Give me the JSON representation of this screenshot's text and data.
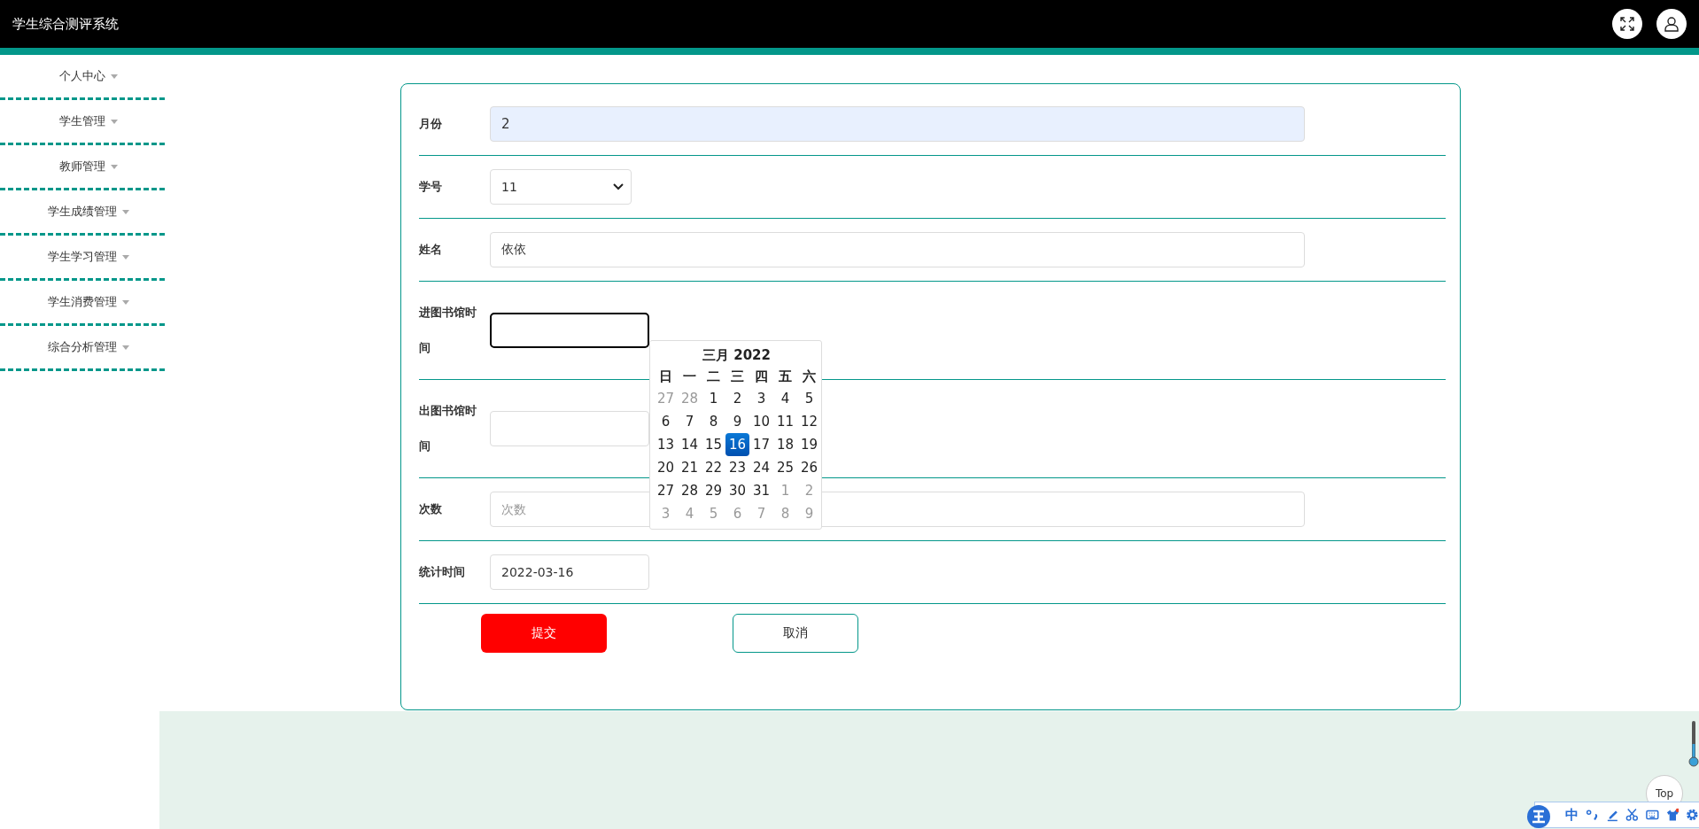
{
  "header": {
    "title": "学生综合测评系统"
  },
  "sidebar": {
    "items": [
      {
        "label": "个人中心"
      },
      {
        "label": "学生管理"
      },
      {
        "label": "教师管理"
      },
      {
        "label": "学生成绩管理"
      },
      {
        "label": "学生学习管理"
      },
      {
        "label": "学生消费管理"
      },
      {
        "label": "综合分析管理"
      }
    ]
  },
  "form": {
    "fields": [
      {
        "kind": "text",
        "label": "月份",
        "value": "2",
        "autofilled": true,
        "focused": false
      },
      {
        "kind": "select",
        "label": "学号",
        "value": "11",
        "autofilled": false,
        "focused": false
      },
      {
        "kind": "text",
        "label": "姓名",
        "value": "依依",
        "autofilled": false,
        "focused": false
      },
      {
        "kind": "date",
        "label": "进图书馆时间",
        "autofilled": false,
        "focused": true
      },
      {
        "kind": "date",
        "label": "出图书馆时间",
        "autofilled": false,
        "focused": false
      },
      {
        "kind": "text",
        "label": "次数",
        "placeholder": "次数",
        "autofilled": false,
        "focused": false
      },
      {
        "kind": "date",
        "label": "统计时间",
        "value": "2022-03-16",
        "autofilled": false,
        "focused": false
      }
    ],
    "buttons": [
      {
        "kind": "primary",
        "label": "提交"
      },
      {
        "kind": "outline",
        "label": "取消"
      }
    ]
  },
  "calendar": {
    "title": "三月 2022",
    "weekdays": [
      "日",
      "一",
      "二",
      "三",
      "四",
      "五",
      "六"
    ],
    "weeks": [
      [
        {
          "day": "27",
          "other_month": true,
          "selected": false
        },
        {
          "day": "28",
          "other_month": true,
          "selected": false
        },
        {
          "day": "1",
          "other_month": false,
          "selected": false
        },
        {
          "day": "2",
          "other_month": false,
          "selected": false
        },
        {
          "day": "3",
          "other_month": false,
          "selected": false
        },
        {
          "day": "4",
          "other_month": false,
          "selected": false
        },
        {
          "day": "5",
          "other_month": false,
          "selected": false
        }
      ],
      [
        {
          "day": "6",
          "other_month": false,
          "selected": false
        },
        {
          "day": "7",
          "other_month": false,
          "selected": false
        },
        {
          "day": "8",
          "other_month": false,
          "selected": false
        },
        {
          "day": "9",
          "other_month": false,
          "selected": false
        },
        {
          "day": "10",
          "other_month": false,
          "selected": false
        },
        {
          "day": "11",
          "other_month": false,
          "selected": false
        },
        {
          "day": "12",
          "other_month": false,
          "selected": false
        }
      ],
      [
        {
          "day": "13",
          "other_month": false,
          "selected": false
        },
        {
          "day": "14",
          "other_month": false,
          "selected": false
        },
        {
          "day": "15",
          "other_month": false,
          "selected": false
        },
        {
          "day": "16",
          "other_month": false,
          "selected": true
        },
        {
          "day": "17",
          "other_month": false,
          "selected": false
        },
        {
          "day": "18",
          "other_month": false,
          "selected": false
        },
        {
          "day": "19",
          "other_month": false,
          "selected": false
        }
      ],
      [
        {
          "day": "20",
          "other_month": false,
          "selected": false
        },
        {
          "day": "21",
          "other_month": false,
          "selected": false
        },
        {
          "day": "22",
          "other_month": false,
          "selected": false
        },
        {
          "day": "23",
          "other_month": false,
          "selected": false
        },
        {
          "day": "24",
          "other_month": false,
          "selected": false
        },
        {
          "day": "25",
          "other_month": false,
          "selected": false
        },
        {
          "day": "26",
          "other_month": false,
          "selected": false
        }
      ],
      [
        {
          "day": "27",
          "other_month": false,
          "selected": false
        },
        {
          "day": "28",
          "other_month": false,
          "selected": false
        },
        {
          "day": "29",
          "other_month": false,
          "selected": false
        },
        {
          "day": "30",
          "other_month": false,
          "selected": false
        },
        {
          "day": "31",
          "other_month": false,
          "selected": false
        },
        {
          "day": "1",
          "other_month": true,
          "selected": false
        },
        {
          "day": "2",
          "other_month": true,
          "selected": false
        }
      ],
      [
        {
          "day": "3",
          "other_month": true,
          "selected": false
        },
        {
          "day": "4",
          "other_month": true,
          "selected": false
        },
        {
          "day": "5",
          "other_month": true,
          "selected": false
        },
        {
          "day": "6",
          "other_month": true,
          "selected": false
        },
        {
          "day": "7",
          "other_month": true,
          "selected": false
        },
        {
          "day": "8",
          "other_month": true,
          "selected": false
        },
        {
          "day": "9",
          "other_month": true,
          "selected": false
        }
      ]
    ]
  },
  "back_to_top": {
    "label": "Top"
  },
  "ime_toolbar": {
    "mode": "中"
  }
}
